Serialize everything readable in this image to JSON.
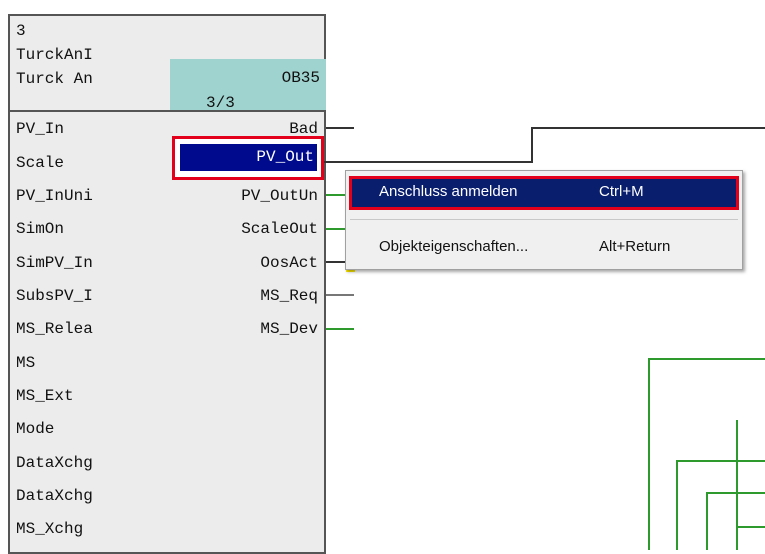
{
  "block": {
    "number": "3",
    "type_name": "TurckAnI",
    "instance_name": "Turck An",
    "runtime_group": "OB35",
    "run_count": "3/3"
  },
  "inputs": [
    "PV_In",
    "Scale",
    "PV_InUni",
    "SimOn",
    "SimPV_In",
    "SubsPV_I",
    "MS_Relea",
    "MS",
    "MS_Ext",
    "Mode",
    "DataXchg",
    "DataXchg",
    "MS_Xchg"
  ],
  "outputs": [
    "Bad",
    "PV_Out",
    "PV_OutUn",
    "ScaleOut",
    "OosAct",
    "MS_Req",
    "MS_Dev"
  ],
  "context_menu": {
    "items": [
      {
        "label": "Anschluss anmelden",
        "shortcut": "Ctrl+M"
      },
      {
        "label": "Objekteigenschaften...",
        "shortcut": "Alt+Return"
      }
    ]
  },
  "colors": {
    "selection": "#000a8c",
    "highlight": "#e2001a",
    "header_cell": "#9fd3cf",
    "wire_green": "#2e9a2e"
  }
}
